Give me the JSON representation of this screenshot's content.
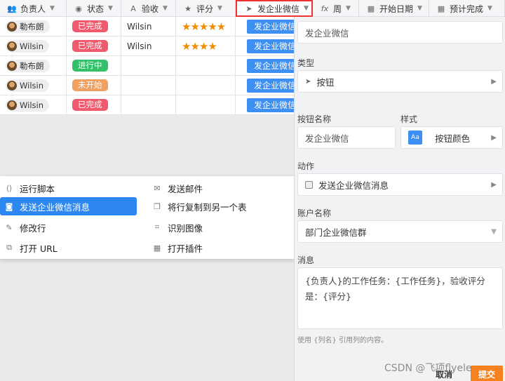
{
  "headers": [
    {
      "icon": "person-icon",
      "glyph": "👥",
      "label": "负责人"
    },
    {
      "icon": "status-icon",
      "glyph": "◉",
      "label": "状态"
    },
    {
      "icon": "text-icon",
      "glyph": "A",
      "label": "验收"
    },
    {
      "icon": "star-icon",
      "glyph": "★",
      "label": "评分"
    },
    {
      "icon": "cursor-icon",
      "glyph": "➤",
      "label": "发企业微信"
    },
    {
      "icon": "formula-icon",
      "glyph": "fx",
      "label": "周"
    },
    {
      "icon": "calendar-icon",
      "glyph": "▦",
      "label": "开始日期"
    },
    {
      "icon": "calendar-icon",
      "glyph": "▦",
      "label": "预计完成"
    }
  ],
  "rows": [
    {
      "owner": "勒布朗",
      "status": "已完成",
      "status_color": "#f05a6e",
      "acceptor": "Wilsin",
      "rating": 5,
      "stars": "★★★★★",
      "button": "发企业微信"
    },
    {
      "owner": "Wilsin",
      "status": "已完成",
      "status_color": "#f05a6e",
      "acceptor": "Wilsin",
      "rating": 4,
      "stars": "★★★★",
      "button": "发企业微信"
    },
    {
      "owner": "勒布朗",
      "status": "进行中",
      "status_color": "#34c06a",
      "acceptor": "",
      "rating": 0,
      "stars": "",
      "button": "发企业微信"
    },
    {
      "owner": "Wilsin",
      "status": "未开始",
      "status_color": "#f0a060",
      "acceptor": "",
      "rating": 0,
      "stars": "",
      "button": "发企业微信"
    },
    {
      "owner": "Wilsin",
      "status": "已完成",
      "status_color": "#f05a6e",
      "acceptor": "",
      "rating": 0,
      "stars": "",
      "button": "发企业微信"
    }
  ],
  "menu": {
    "items": [
      {
        "icon": "script-icon",
        "glyph": "⟨⟩",
        "label": "运行脚本",
        "active": false
      },
      {
        "icon": "mail-icon",
        "glyph": "✉",
        "label": "发送邮件",
        "active": false
      },
      {
        "icon": "wechat-icon",
        "glyph": "◙",
        "label": "发送企业微信消息",
        "active": true
      },
      {
        "icon": "copy-icon",
        "glyph": "❐",
        "label": "将行复制到另一个表",
        "active": false
      },
      {
        "icon": "edit-row-icon",
        "glyph": "✎",
        "label": "修改行",
        "active": false
      },
      {
        "icon": "scan-icon",
        "glyph": "⌗",
        "label": "识别图像",
        "active": false
      },
      {
        "icon": "link-icon",
        "glyph": "⧉",
        "label": "打开 URL",
        "active": false
      },
      {
        "icon": "plugin-icon",
        "glyph": "▦",
        "label": "打开插件",
        "active": false
      }
    ]
  },
  "panel": {
    "field_name": "发企业微信",
    "type_label": "类型",
    "type_value": "按钮",
    "button_name_label": "按钮名称",
    "button_name_value": "发企业微信",
    "style_label": "样式",
    "style_icon_text": "Aa",
    "style_value": "按钮颜色",
    "action_label": "动作",
    "action_value": "发送企业微信消息",
    "account_label": "账户名称",
    "account_value": "部门企业微信群",
    "message_label": "消息",
    "message_value": "{负责人}的工作任务：{工作任务}，验收评分是：{评分}",
    "hint": "使用 {列名} 引用列的内容。",
    "cancel_label": "取消",
    "submit_label": "提交"
  },
  "colors": {
    "accent": "#2d87f0",
    "selected_border": "#ee3333",
    "submit": "#f5821f"
  },
  "watermark": "CSDN @飞项flyele"
}
